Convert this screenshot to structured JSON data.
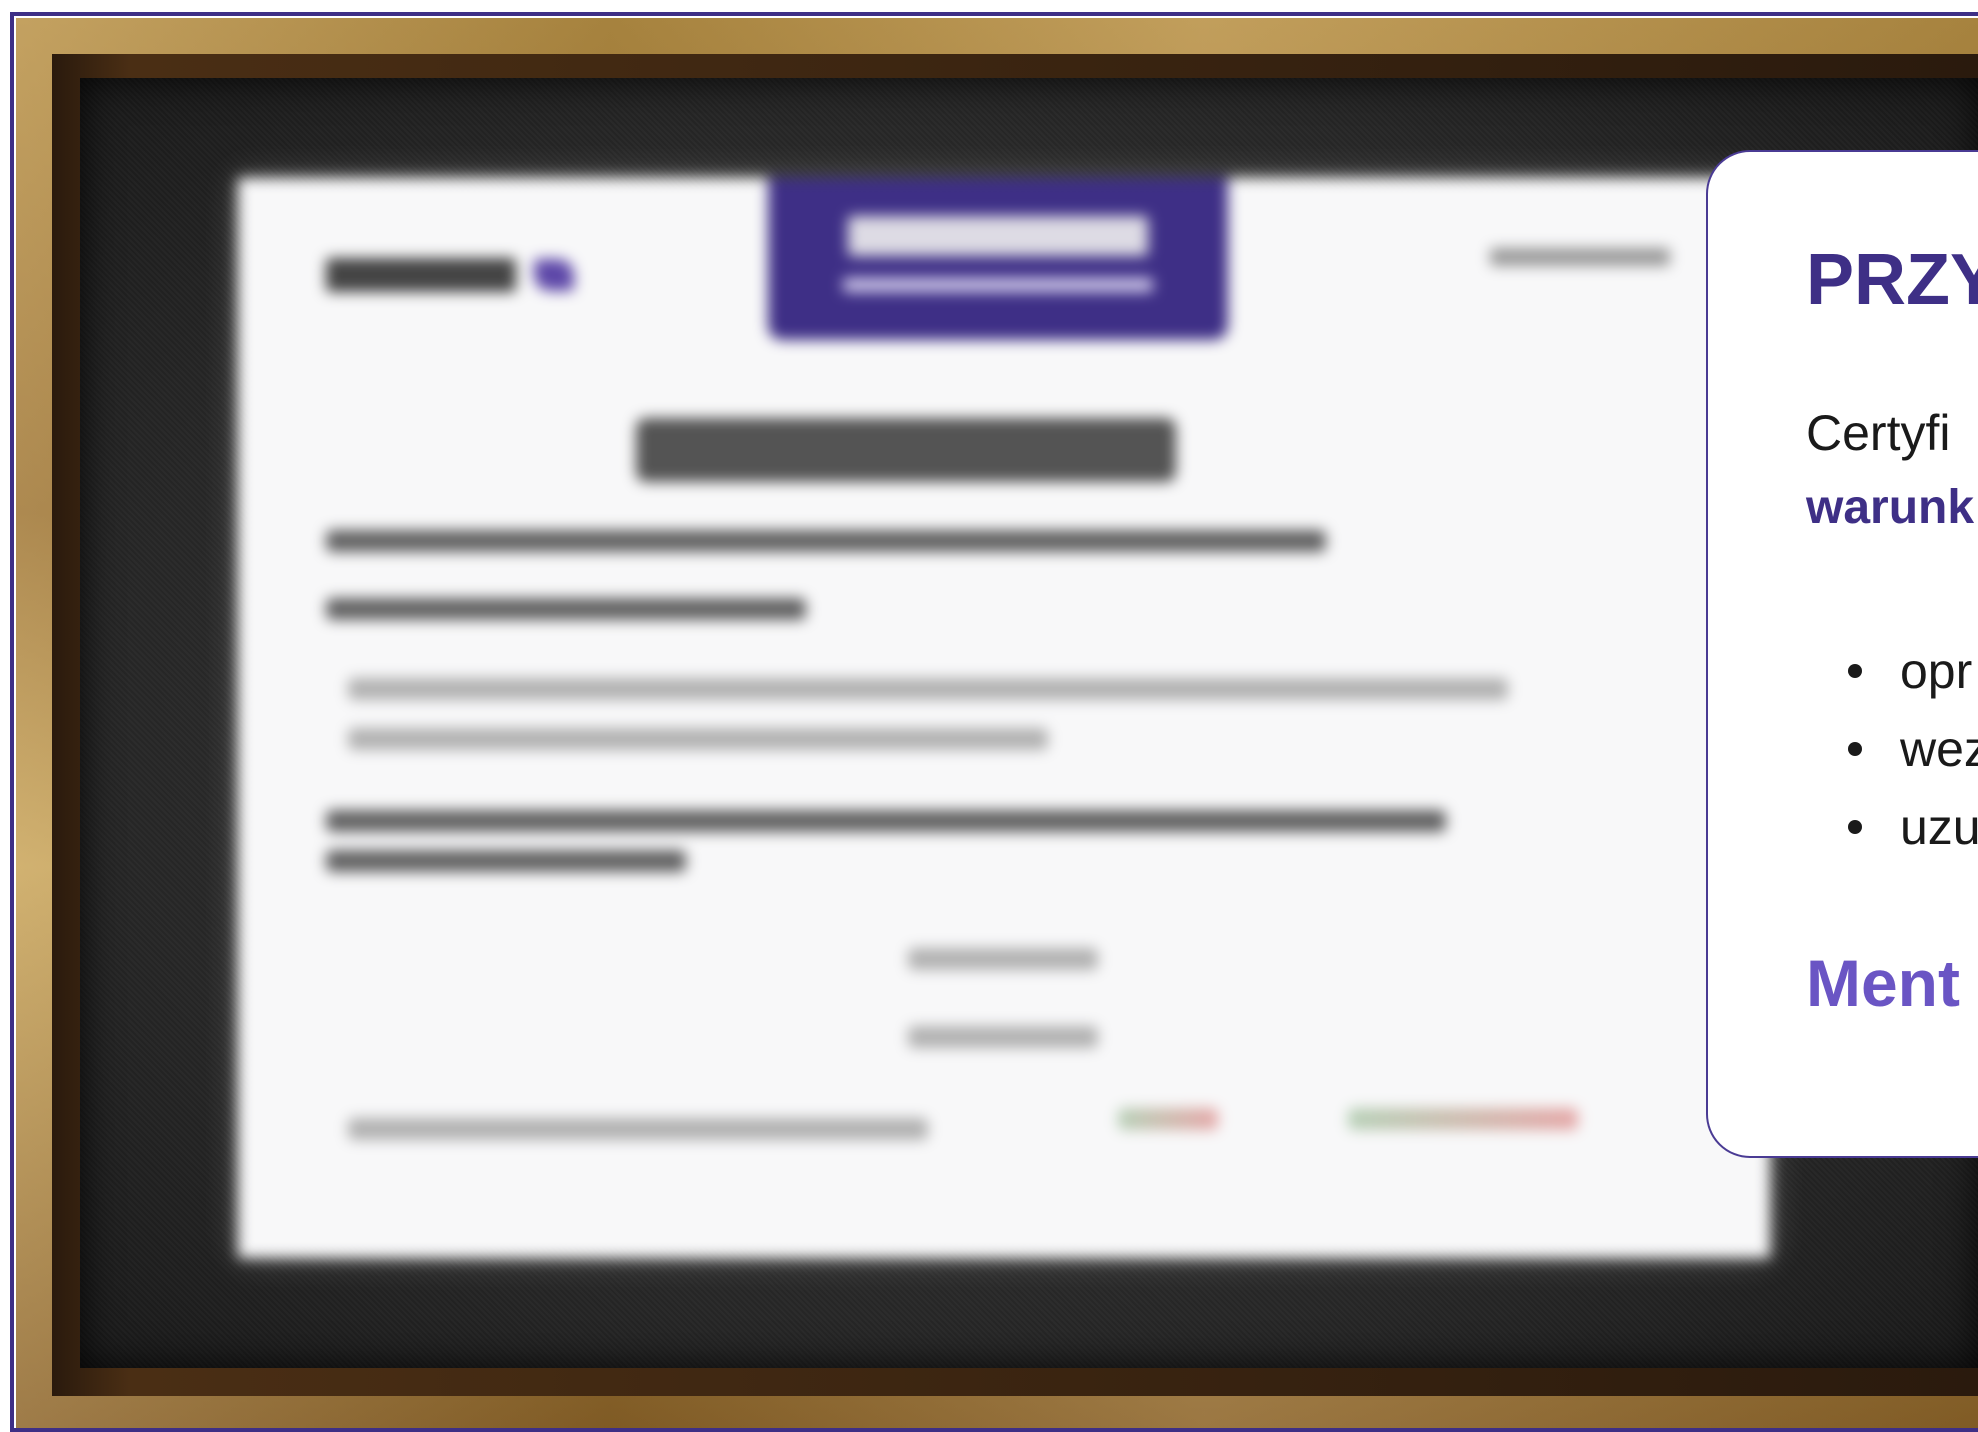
{
  "colors": {
    "accent": "#3e2f86",
    "accent_light": "#6a55c4",
    "frame_gold": "#b99145",
    "mat_dark": "#262626"
  },
  "certificate": {
    "state": "blurred",
    "icons": [
      "logo-mark"
    ]
  },
  "info_card": {
    "title": "PRZY",
    "intro": "Certyfi",
    "intro_bold": "warunk",
    "list_items": [
      "opr",
      "wez",
      "uzu"
    ],
    "footer": "Ment"
  }
}
